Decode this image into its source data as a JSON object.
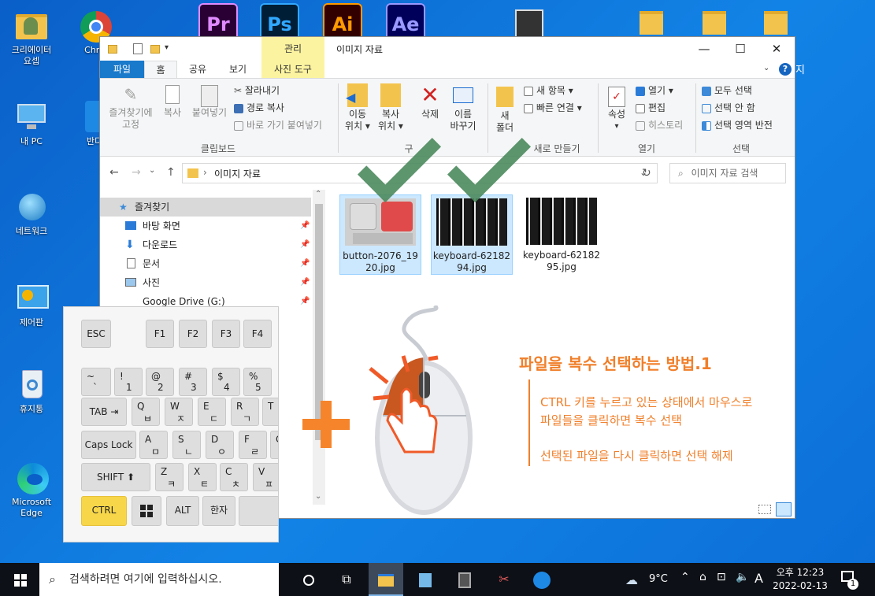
{
  "desktop": {
    "icons": [
      {
        "label": "크리에이터\n요셉",
        "name": "desktop-icon-creator-folder"
      },
      {
        "label": "Chro",
        "name": "desktop-icon-chrome"
      },
      {
        "label": "내 PC",
        "name": "desktop-icon-this-pc"
      },
      {
        "label": "반디",
        "name": "desktop-icon-bandi"
      },
      {
        "label": "네트워크",
        "name": "desktop-icon-network"
      },
      {
        "label": "제어판",
        "name": "desktop-icon-control-panel"
      },
      {
        "label": "휴지통",
        "name": "desktop-icon-recycle-bin"
      },
      {
        "label": "Microsoft\nEdge",
        "name": "desktop-icon-edge"
      }
    ],
    "apps": [
      "Pr",
      "Ps",
      "Ai",
      "Ae"
    ],
    "side_text": "지"
  },
  "explorer": {
    "title": "이미지 자료",
    "context_tab": "관리",
    "tabs": [
      "파일",
      "홈",
      "공유",
      "보기",
      "사진 도구"
    ],
    "ribbon": {
      "clipboard": {
        "pin": "즐겨찾기에\n고정",
        "copy": "복사",
        "paste": "붙여넣기",
        "cut": "잘라내기",
        "copy_path": "경로 복사",
        "paste_shortcut": "바로 가기 붙여넣기",
        "label": "클립보드"
      },
      "organize": {
        "move": "이동\n위치 ▾",
        "copy_to": "복사\n위치 ▾",
        "delete": "삭제",
        "rename": "이름\n바꾸기",
        "label": "구"
      },
      "new": {
        "new_folder": "새\n폴더",
        "new_item": "새 항목 ▾",
        "easy_access": "빠른 연결 ▾",
        "label": "새로 만들기"
      },
      "open": {
        "properties": "속성",
        "open": "열기 ▾",
        "edit": "편집",
        "history": "히스토리",
        "label": "열기"
      },
      "select": {
        "all": "모두 선택",
        "none": "선택 안 함",
        "invert": "선택 영역 반전",
        "label": "선택"
      }
    },
    "address": {
      "path": "이미지 자료",
      "search_placeholder": "이미지 자료 검색"
    },
    "nav": {
      "quick_access": "즐겨찾기",
      "items": [
        "바탕 화면",
        "다운로드",
        "문서",
        "사진",
        "Google Drive (G:)"
      ]
    },
    "files": [
      {
        "name": "button-2076_19\n20.jpg",
        "selected": true
      },
      {
        "name": "keyboard-62182\n94.jpg",
        "selected": true
      },
      {
        "name": "keyboard-62182\n95.jpg",
        "selected": false
      }
    ]
  },
  "keyboard": {
    "row1": [
      "ESC",
      "F1",
      "F2",
      "F3",
      "F4"
    ],
    "row2": [
      [
        "~",
        "`"
      ],
      [
        "!",
        "1"
      ],
      [
        "@",
        "2"
      ],
      [
        "#",
        "3"
      ],
      [
        "$",
        "4"
      ],
      [
        "%",
        "5"
      ]
    ],
    "row3_tab": "TAB",
    "row3": [
      [
        "Q",
        "ㅂ"
      ],
      [
        "W",
        "ㅈ"
      ],
      [
        "E",
        "ㄷ"
      ],
      [
        "R",
        "ㄱ"
      ],
      [
        "T",
        ""
      ]
    ],
    "row4_caps": "Caps Lock",
    "row4": [
      [
        "A",
        "ㅁ"
      ],
      [
        "S",
        "ㄴ"
      ],
      [
        "D",
        "ㅇ"
      ],
      [
        "F",
        "ㄹ"
      ],
      [
        "G",
        ""
      ]
    ],
    "row5_shift": "SHIFT",
    "row5": [
      [
        "Z",
        "ㅋ"
      ],
      [
        "X",
        "ㅌ"
      ],
      [
        "C",
        "ㅊ"
      ],
      [
        "V",
        "ㅍ"
      ]
    ],
    "row6": [
      "CTRL",
      "",
      "ALT",
      "한자"
    ]
  },
  "annotation": {
    "title": "파일을 복수 선택하는 방법.1",
    "line1": "CTRL 키를 누르고 있는 상태에서 마우스로",
    "line2": "파일들을 클릭하면 복수 선택",
    "line3": "선택된 파일을 다시 클릭하면 선택 해제",
    "accent": "#f07f2a"
  },
  "taskbar": {
    "search_placeholder": "검색하려면 여기에 입력하십시오.",
    "weather": "9°C",
    "ime": "A",
    "time": "오후 12:23",
    "date": "2022-02-13",
    "notification_count": "1"
  }
}
